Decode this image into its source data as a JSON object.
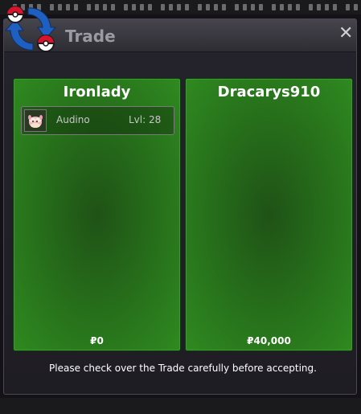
{
  "window": {
    "title": "Trade",
    "close_symbol": "✕"
  },
  "left_panel": {
    "trainer": "Ironlady",
    "pokemon": {
      "name": "Audino",
      "level": "Lvl: 28",
      "icon": "audino-sprite-icon"
    },
    "money": "₽0"
  },
  "right_panel": {
    "trainer": "Dracarys910",
    "money": "₽40,000"
  },
  "message": "Please check over the Trade carefully before accepting.",
  "colors": {
    "panel_green": "#2f8a20",
    "panel_dark": "#1f5216",
    "title_gray": "#9b9aa2",
    "pokeball_red": "#d8132b",
    "arrow_blue": "#1e5fc0"
  }
}
